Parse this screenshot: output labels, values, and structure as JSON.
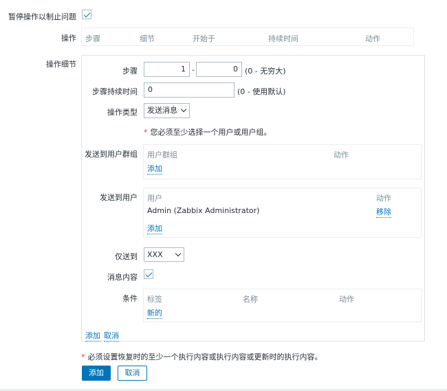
{
  "pause_label": "暂停操作以制止问题",
  "operations": {
    "label": "操作",
    "headers": [
      "步骤",
      "细节",
      "开始于",
      "持续时间",
      "动作"
    ]
  },
  "details": {
    "label": "操作细节",
    "steps": {
      "label": "步骤",
      "from": "1",
      "separator": "-",
      "to": "0",
      "hint": "(0 - 无穷大)"
    },
    "step_duration": {
      "label": "步骤持续时间",
      "value": "0",
      "hint": "(0 - 使用默认)"
    },
    "operation_type": {
      "label": "操作类型",
      "value": "发送消息"
    },
    "required_note": "您必须至少选择一个用户或用户组。",
    "user_groups": {
      "label": "发送到用户群组",
      "col_group": "用户群组",
      "col_action": "动作",
      "add": "添加"
    },
    "users": {
      "label": "发送到用户",
      "col_user": "用户",
      "col_action": "动作",
      "rows": [
        {
          "name": "Admin (Zabbix Administrator)",
          "action": "移除"
        }
      ],
      "add": "添加"
    },
    "send_only_to": {
      "label": "仅送到",
      "value": "XXX"
    },
    "message_content": {
      "label": "消息内容"
    },
    "conditions": {
      "label": "条件",
      "col_label": "标签",
      "col_name": "名称",
      "col_action": "动作",
      "new": "新的"
    },
    "add": "添加",
    "cancel": "取消"
  },
  "footer_note": "必须设置恢复时的至少一个执行内容或执行内容或更新时的执行内容。",
  "buttons": {
    "add": "添加",
    "cancel": "取消"
  },
  "colors": {
    "accent": "#0275b8",
    "required": "#e33734",
    "muted": "#768d99"
  }
}
